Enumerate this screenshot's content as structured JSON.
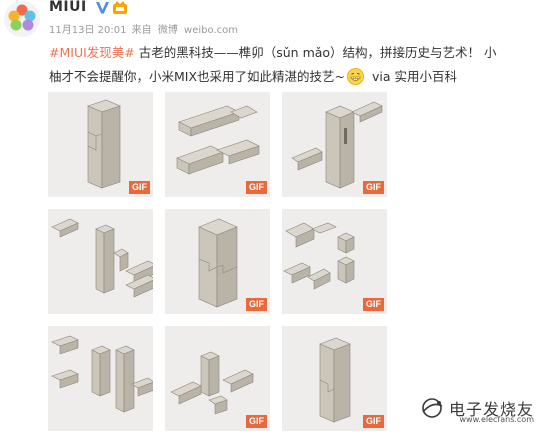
{
  "post": {
    "username": "MIUI",
    "meta": {
      "date": "11月13日 20:01",
      "from_label": "来自",
      "source": "微博",
      "site": "weibo.com"
    },
    "text": {
      "topic": "#MIUI发现美#",
      "line1_rest": " 古老的黑科技——榫卯（sǔn mǎo）结构，拼接历史与艺术！ 小",
      "line2": "柚才不会提醒你，小米MIX也采用了如此精湛的技艺~",
      "via": " via 实用小百科"
    }
  },
  "grid": {
    "gif_label": "GIF",
    "cells": [
      {
        "kind": "tall",
        "gif": true
      },
      {
        "kind": "beams",
        "gif": true
      },
      {
        "kind": "post-beam",
        "gif": true
      },
      {
        "kind": "explode",
        "gif": true
      },
      {
        "kind": "block",
        "gif": true
      },
      {
        "kind": "parts",
        "gif": true
      },
      {
        "kind": "assembly",
        "gif": true
      },
      {
        "kind": "cross",
        "gif": true
      },
      {
        "kind": "single",
        "gif": true
      }
    ]
  },
  "watermark": {
    "text": "电子发烧友",
    "sub": "www.elecfans.com"
  },
  "colors": {
    "accent": "#eb7350",
    "gif_badge": "#e8693b",
    "wood_top": "#dcd7ce",
    "wood_left": "#cbc5ba",
    "wood_right": "#b9b3a8"
  }
}
